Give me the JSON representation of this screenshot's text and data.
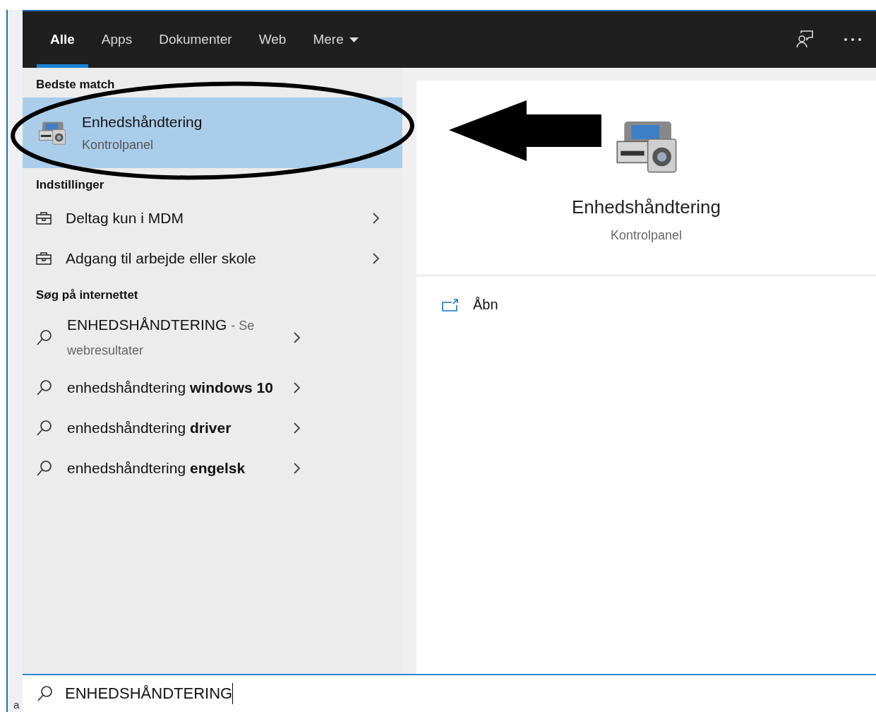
{
  "background": {
    "fragment": "a"
  },
  "tabs": [
    {
      "label": "Alle",
      "selected": true,
      "has_menu": false
    },
    {
      "label": "Apps",
      "selected": false,
      "has_menu": false
    },
    {
      "label": "Dokumenter",
      "selected": false,
      "has_menu": false
    },
    {
      "label": "Web",
      "selected": false,
      "has_menu": false
    },
    {
      "label": "Mere",
      "selected": false,
      "has_menu": true
    }
  ],
  "best_match": {
    "heading": "Bedste match",
    "title": "Enhedshåndtering",
    "subtitle": "Kontrolpanel",
    "selected": true
  },
  "settings": {
    "heading": "Indstillinger",
    "items": [
      {
        "label": "Deltag kun i MDM"
      },
      {
        "label": "Adgang til arbejde eller skole"
      }
    ]
  },
  "web": {
    "heading": "Søg på internettet",
    "items": [
      {
        "text": "ENHEDSHÅNDTERING",
        "hint": "- Se webresultater"
      },
      {
        "text": "enhedshåndtering **windows 10**"
      },
      {
        "text": "enhedshåndtering **driver**"
      },
      {
        "text": "enhedshåndtering **engelsk**"
      }
    ]
  },
  "detail": {
    "title": "Enhedshåndtering",
    "subtitle": "Kontrolpanel",
    "actions": [
      {
        "label": "Åbn"
      }
    ]
  },
  "search": {
    "value": "ENHEDSHÅNDTERING"
  },
  "annotations": [
    {
      "kind": "ellipse"
    },
    {
      "kind": "arrow"
    }
  ]
}
